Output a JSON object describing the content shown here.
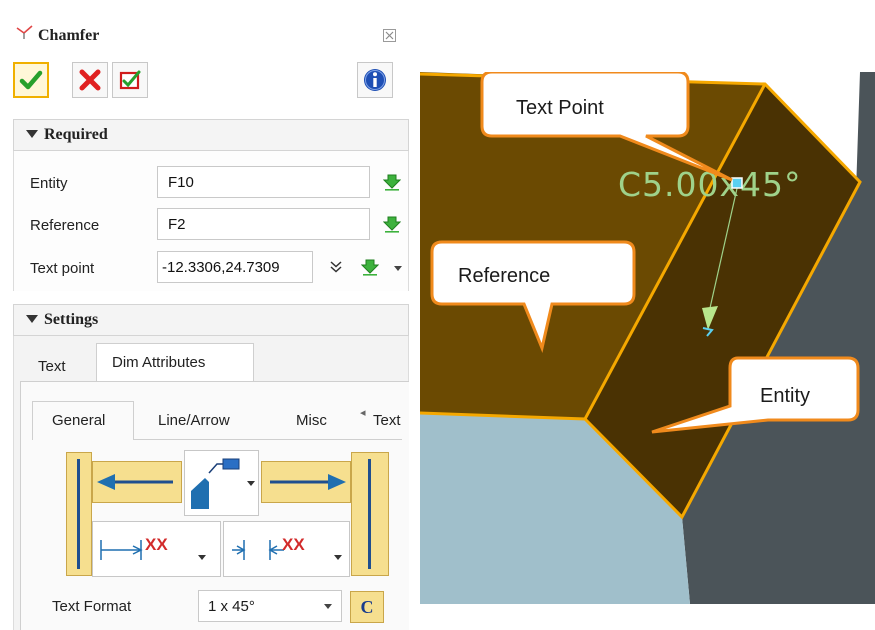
{
  "dialog": {
    "title": "Chamfer",
    "buttons": {
      "ok_icon": "green-check-icon",
      "cancel_icon": "red-x-icon",
      "apply_icon": "apply-check-icon",
      "info_icon": "info-icon"
    }
  },
  "required": {
    "header": "Required",
    "fields": [
      {
        "label": "Entity",
        "value": "F10"
      },
      {
        "label": "Reference",
        "value": "F2"
      },
      {
        "label": "Text point",
        "value": "-12.3306,24.7309"
      }
    ]
  },
  "settings": {
    "header": "Settings",
    "tabs": [
      "Text",
      "Dim Attributes"
    ],
    "active_tab": "Dim Attributes",
    "subtabs": [
      "General",
      "Line/Arrow",
      "Misc",
      "Text"
    ],
    "active_subtab": "General",
    "text_format_label": "Text Format",
    "text_format_value": "1 x 45°",
    "format_button": "C",
    "dim_marker": "XX"
  },
  "viewport": {
    "dimension_text": "C5.00x45°",
    "callouts": {
      "text_point": "Text Point",
      "reference": "Reference",
      "entity": "Entity"
    },
    "colors": {
      "face_left": "#6b4a02",
      "face_right": "#4a3203",
      "highlight_edge": "#f5a800",
      "callout_border": "#f08a1c",
      "dimension_text": "#9fd28a",
      "floor": "#9fbfcb",
      "wall": "#4a5358"
    }
  }
}
